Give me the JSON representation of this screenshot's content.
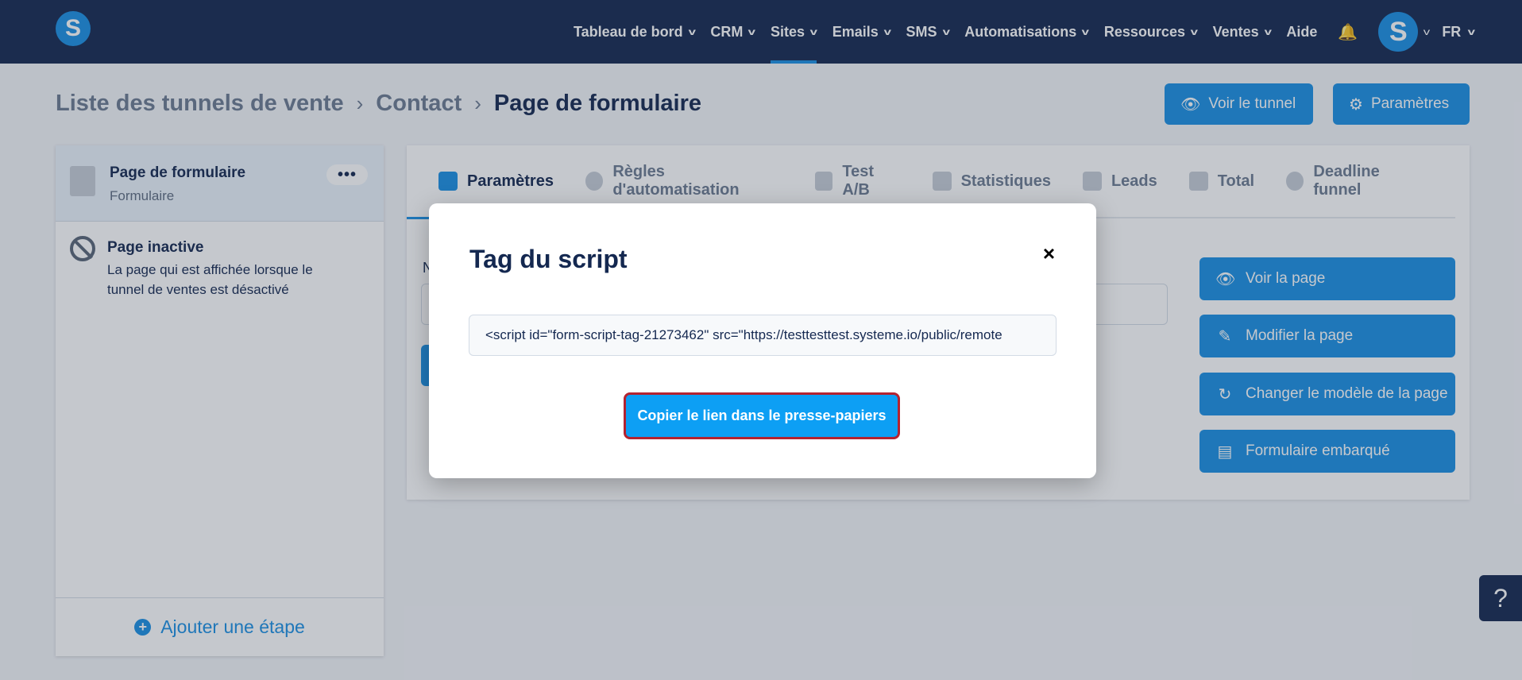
{
  "app": {
    "logo_letter": "S"
  },
  "nav": {
    "items": [
      {
        "label": "Tableau de bord",
        "has_chevron": true
      },
      {
        "label": "CRM",
        "has_chevron": true
      },
      {
        "label": "Sites",
        "has_chevron": true,
        "active": true
      },
      {
        "label": "Emails",
        "has_chevron": true
      },
      {
        "label": "SMS",
        "has_chevron": true
      },
      {
        "label": "Automatisations",
        "has_chevron": true
      },
      {
        "label": "Ressources",
        "has_chevron": true
      },
      {
        "label": "Ventes",
        "has_chevron": true
      },
      {
        "label": "Aide",
        "has_chevron": false
      }
    ],
    "avatar_letter": "S",
    "language": "FR"
  },
  "breadcrumb": [
    "Liste des tunnels de vente",
    "Contact",
    "Page de formulaire"
  ],
  "header_buttons": {
    "view_funnel": "Voir le tunnel",
    "settings": "Paramètres"
  },
  "sidebar": {
    "active_step": {
      "title": "Page de formulaire",
      "subtitle": "Formulaire",
      "menu": "•••"
    },
    "inactive_step": {
      "title": "Page inactive",
      "description": "La page qui est affichée lorsque le tunnel de ventes est désactivé"
    },
    "add_step": "Ajouter une étape"
  },
  "tabs": [
    {
      "label": "Paramètres",
      "active": true
    },
    {
      "label": "Règles d'automatisation"
    },
    {
      "label": "Test A/B"
    },
    {
      "label": "Statistiques"
    },
    {
      "label": "Leads"
    },
    {
      "label": "Total"
    },
    {
      "label": "Deadline funnel"
    }
  ],
  "main": {
    "field_label": "N"
  },
  "actions": {
    "view_page": "Voir la page",
    "edit_page": "Modifier la page",
    "change_template": "Changer le modèle de la page",
    "embedded_form": "Formulaire embarqué"
  },
  "help": "?",
  "modal": {
    "title": "Tag du script",
    "close": "×",
    "script_value": "<script id=\"form-script-tag-21273462\" src=\"https://testtesttest.systeme.io/public/remote",
    "copy_button": "Copier le lien dans le presse-papiers"
  },
  "colors": {
    "navy": "#142850",
    "accent": "#1a8fe3",
    "copy_button": "#0d9ff4",
    "highlight_border": "#b42330"
  }
}
